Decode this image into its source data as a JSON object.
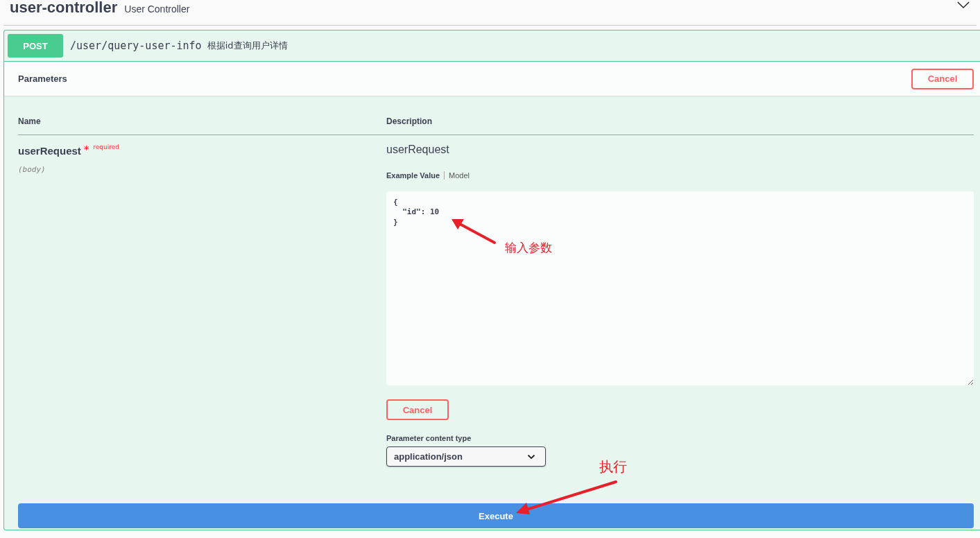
{
  "section": {
    "title": "user-controller",
    "description": "User Controller",
    "expanded": true
  },
  "operation": {
    "method": "POST",
    "path": "/user/query-user-info",
    "summary": "根据id查询用户详情"
  },
  "parameters_header": {
    "title": "Parameters",
    "cancel_label": "Cancel"
  },
  "table": {
    "columns": [
      "Name",
      "Description"
    ],
    "rows": [
      {
        "name": "userRequest",
        "required_mark": "*",
        "required_label": "required",
        "location": "(body)",
        "description": "userRequest",
        "tabs": [
          {
            "label": "Example Value",
            "selected": true
          },
          {
            "label": "Model",
            "selected": false
          }
        ],
        "body_value": "{\n  \"id\": 10\n}"
      }
    ]
  },
  "cancel_button": "Cancel",
  "content_type": {
    "label": "Parameter content type",
    "value": "application/json"
  },
  "execute_button": "Execute",
  "annotations": [
    {
      "text": "输入参数"
    },
    {
      "text": "执行"
    }
  ]
}
